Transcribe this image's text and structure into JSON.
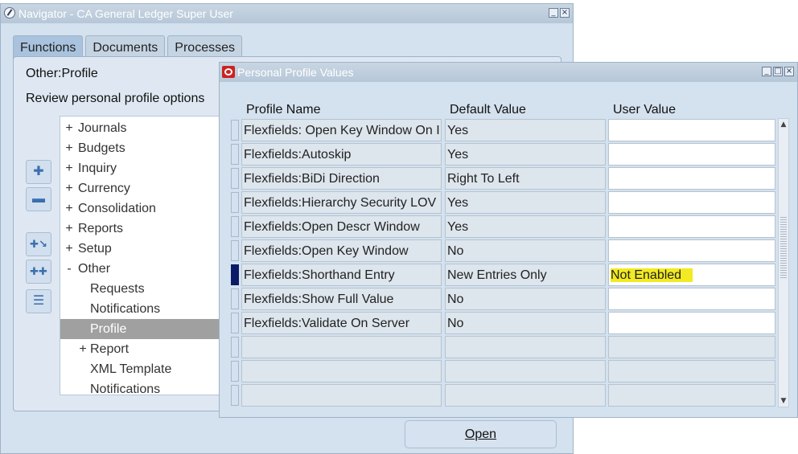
{
  "navigator": {
    "title": "Navigator - CA General Ledger Super User",
    "tabs": [
      "Functions",
      "Documents",
      "Processes"
    ],
    "breadcrumb": "Other:Profile",
    "description": "Review personal profile options",
    "tree": [
      {
        "sign": "+",
        "label": "Journals",
        "indent": 0
      },
      {
        "sign": "+",
        "label": "Budgets",
        "indent": 0
      },
      {
        "sign": "+",
        "label": "Inquiry",
        "indent": 0
      },
      {
        "sign": "+",
        "label": "Currency",
        "indent": 0
      },
      {
        "sign": "+",
        "label": "Consolidation",
        "indent": 0
      },
      {
        "sign": "+",
        "label": "Reports",
        "indent": 0
      },
      {
        "sign": "+",
        "label": "Setup",
        "indent": 0
      },
      {
        "sign": "-",
        "label": "Other",
        "indent": 0
      },
      {
        "sign": "",
        "label": "Requests",
        "indent": 1
      },
      {
        "sign": "",
        "label": "Notifications",
        "indent": 1
      },
      {
        "sign": "",
        "label": "Profile",
        "indent": 1,
        "selected": true
      },
      {
        "sign": "+",
        "label": "Report",
        "indent": 1
      },
      {
        "sign": "",
        "label": "XML Template",
        "indent": 1
      },
      {
        "sign": "",
        "label": "Notifications",
        "indent": 1
      }
    ],
    "open_button": "Open"
  },
  "profile_dialog": {
    "title": "Personal Profile Values",
    "columns": [
      "Profile Name",
      "Default Value",
      "User Value"
    ],
    "rows": [
      {
        "name": "Flexfields: Open Key Window On I",
        "default": "Yes",
        "user": ""
      },
      {
        "name": "Flexfields:Autoskip",
        "default": "Yes",
        "user": ""
      },
      {
        "name": "Flexfields:BiDi Direction",
        "default": "Right To Left",
        "user": ""
      },
      {
        "name": "Flexfields:Hierarchy Security LOV",
        "default": "Yes",
        "user": ""
      },
      {
        "name": "Flexfields:Open Descr Window",
        "default": "Yes",
        "user": ""
      },
      {
        "name": "Flexfields:Open Key Window",
        "default": "No",
        "user": ""
      },
      {
        "name": "Flexfields:Shorthand Entry",
        "default": "New Entries Only",
        "user": "Not Enabled",
        "current": true
      },
      {
        "name": "Flexfields:Show Full Value",
        "default": "No",
        "user": ""
      },
      {
        "name": "Flexfields:Validate On Server",
        "default": "No",
        "user": ""
      },
      {
        "name": "",
        "default": "",
        "user": "",
        "empty": true
      },
      {
        "name": "",
        "default": "",
        "user": "",
        "empty": true
      },
      {
        "name": "",
        "default": "",
        "user": "",
        "empty": true
      }
    ],
    "highlight_color": "#f2ea22"
  }
}
